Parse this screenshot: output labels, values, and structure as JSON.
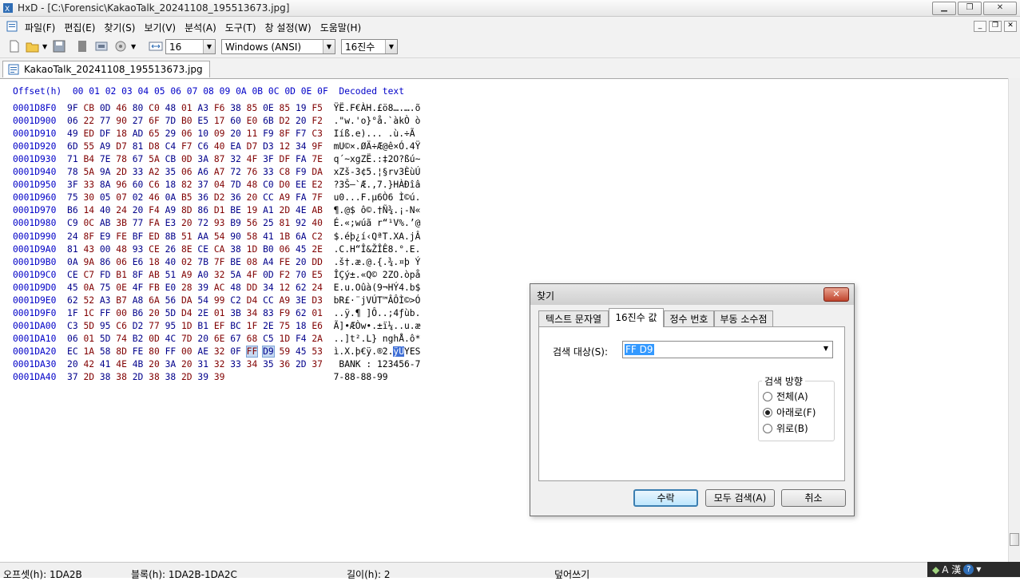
{
  "window": {
    "title": "HxD - [C:\\Forensic\\KakaoTalk_20241108_195513673.jpg]"
  },
  "menu": [
    "파일(F)",
    "편집(E)",
    "찾기(S)",
    "보기(V)",
    "분석(A)",
    "도구(T)",
    "창 설정(W)",
    "도움말(H)"
  ],
  "toolbar": {
    "bytes_per_row": "16",
    "charset": "Windows (ANSI)",
    "base": "16진수"
  },
  "tab": {
    "label": "KakaoTalk_20241108_195513673.jpg"
  },
  "hex": {
    "header_offset": "Offset(h)",
    "header_columns": [
      "00",
      "01",
      "02",
      "03",
      "04",
      "05",
      "06",
      "07",
      "08",
      "09",
      "0A",
      "0B",
      "0C",
      "0D",
      "0E",
      "0F"
    ],
    "header_text": "Decoded text",
    "rows": [
      {
        "offset": "0001D8F0",
        "bytes": [
          "9F",
          "CB",
          "0D",
          "46",
          "80",
          "C0",
          "48",
          "01",
          "A3",
          "F6",
          "38",
          "85",
          "0E",
          "85",
          "19",
          "F5"
        ],
        "text": "ŸË.F€ÀH.£ö8….….õ"
      },
      {
        "offset": "0001D900",
        "bytes": [
          "06",
          "22",
          "77",
          "90",
          "27",
          "6F",
          "7D",
          "B0",
          "E5",
          "17",
          "60",
          "E0",
          "6B",
          "D2",
          "20",
          "F2"
        ],
        "text": ".\"w.'o}°å.`àkÒ ò"
      },
      {
        "offset": "0001D910",
        "bytes": [
          "49",
          "ED",
          "DF",
          "18",
          "AD",
          "65",
          "29",
          "06",
          "10",
          "09",
          "20",
          "11",
          "F9",
          "8F",
          "F7",
          "C3"
        ],
        "text": "Iíß.­e)... .ù.÷Ã"
      },
      {
        "offset": "0001D920",
        "bytes": [
          "6D",
          "55",
          "A9",
          "D7",
          "81",
          "D8",
          "C4",
          "F7",
          "C6",
          "40",
          "EA",
          "D7",
          "D3",
          "12",
          "34",
          "9F"
        ],
        "text": "mU©×.ØÄ÷Æ@ê×Ó.4Ÿ"
      },
      {
        "offset": "0001D930",
        "bytes": [
          "71",
          "B4",
          "7E",
          "78",
          "67",
          "5A",
          "CB",
          "0D",
          "3A",
          "87",
          "32",
          "4F",
          "3F",
          "DF",
          "FA",
          "7E"
        ],
        "text": "q´~xgZË.:‡2O?ßú~"
      },
      {
        "offset": "0001D940",
        "bytes": [
          "78",
          "5A",
          "9A",
          "2D",
          "33",
          "A2",
          "35",
          "06",
          "A6",
          "A7",
          "72",
          "76",
          "33",
          "C8",
          "F9",
          "DA"
        ],
        "text": "xZš-3¢5.¦§rv3ÈùÚ"
      },
      {
        "offset": "0001D950",
        "bytes": [
          "3F",
          "33",
          "8A",
          "96",
          "60",
          "C6",
          "18",
          "82",
          "37",
          "04",
          "7D",
          "48",
          "C0",
          "D0",
          "EE",
          "E2"
        ],
        "text": "?3Š–`Æ.‚7.}HÀÐîâ"
      },
      {
        "offset": "0001D960",
        "bytes": [
          "75",
          "30",
          "05",
          "07",
          "02",
          "46",
          "0A",
          "B5",
          "36",
          "D2",
          "36",
          "20",
          "CC",
          "A9",
          "FA",
          "7F"
        ],
        "text": "u0...F.µ6Ò6 Ì©ú."
      },
      {
        "offset": "0001D970",
        "bytes": [
          "B6",
          "14",
          "40",
          "24",
          "20",
          "F4",
          "A9",
          "8D",
          "86",
          "D1",
          "BE",
          "19",
          "A1",
          "2D",
          "4E",
          "AB"
        ],
        "text": "¶.@$ ô©.†Ñ¾.¡-N«"
      },
      {
        "offset": "0001D980",
        "bytes": [
          "C9",
          "0C",
          "AB",
          "3B",
          "77",
          "FA",
          "E3",
          "20",
          "72",
          "93",
          "B9",
          "56",
          "25",
          "81",
          "92",
          "40"
        ],
        "text": "É.«;wúã r“¹V%.’@"
      },
      {
        "offset": "0001D990",
        "bytes": [
          "24",
          "8F",
          "E9",
          "FE",
          "BF",
          "ED",
          "8B",
          "51",
          "AA",
          "54",
          "90",
          "58",
          "41",
          "1B",
          "6A",
          "C2"
        ],
        "text": "$.éþ¿í‹QªT.XA.jÂ"
      },
      {
        "offset": "0001D9A0",
        "bytes": [
          "81",
          "43",
          "00",
          "48",
          "93",
          "CE",
          "26",
          "8E",
          "CE",
          "CA",
          "38",
          "1D",
          "B0",
          "06",
          "45",
          "2E"
        ],
        "text": ".C.H“Î&ŽÎÊ8.°.E."
      },
      {
        "offset": "0001D9B0",
        "bytes": [
          "0A",
          "9A",
          "86",
          "06",
          "E6",
          "18",
          "40",
          "02",
          "7B",
          "7F",
          "BE",
          "08",
          "A4",
          "FE",
          "20",
          "DD"
        ],
        "text": ".š†.æ.@.{.¾.¤þ Ý"
      },
      {
        "offset": "0001D9C0",
        "bytes": [
          "CE",
          "C7",
          "FD",
          "B1",
          "8F",
          "AB",
          "51",
          "A9",
          "A0",
          "32",
          "5A",
          "4F",
          "0D",
          "F2",
          "70",
          "E5"
        ],
        "text": "ÎÇý±.«Q© 2ZO.òpå"
      },
      {
        "offset": "0001D9D0",
        "bytes": [
          "45",
          "0A",
          "75",
          "0E",
          "4F",
          "FB",
          "E0",
          "28",
          "39",
          "AC",
          "48",
          "DD",
          "34",
          "12",
          "62",
          "24"
        ],
        "text": "E.u.Oûà(9¬HÝ4.b$"
      },
      {
        "offset": "0001D9E0",
        "bytes": [
          "62",
          "52",
          "A3",
          "B7",
          "A8",
          "6A",
          "56",
          "DA",
          "54",
          "99",
          "C2",
          "D4",
          "CC",
          "A9",
          "3E",
          "D3"
        ],
        "text": "bR£·¨jVÚT™ÂÔÌ©>Ó"
      },
      {
        "offset": "0001D9F0",
        "bytes": [
          "1F",
          "1C",
          "FF",
          "00",
          "B6",
          "20",
          "5D",
          "D4",
          "2E",
          "01",
          "3B",
          "34",
          "83",
          "F9",
          "62",
          "01"
        ],
        "text": "..ÿ.¶ ]Ô..;4ƒùb."
      },
      {
        "offset": "0001DA00",
        "bytes": [
          "C3",
          "5D",
          "95",
          "C6",
          "D2",
          "77",
          "95",
          "1D",
          "B1",
          "EF",
          "BC",
          "1F",
          "2E",
          "75",
          "18",
          "E6"
        ],
        "text": "Ã]•ÆÒw•.±ï¼..u.æ"
      },
      {
        "offset": "0001DA10",
        "bytes": [
          "06",
          "01",
          "5D",
          "74",
          "B2",
          "0D",
          "4C",
          "7D",
          "20",
          "6E",
          "67",
          "68",
          "C5",
          "1D",
          "F4",
          "2A"
        ],
        "text": "..]t².L} nghÅ.ô*"
      },
      {
        "offset": "0001DA20",
        "bytes": [
          "EC",
          "1A",
          "58",
          "8D",
          "FE",
          "80",
          "FF",
          "00",
          "AE",
          "32",
          "0F",
          "FF",
          "D9",
          "59",
          "45",
          "53"
        ],
        "text": "ì.X.þ€ÿ.®2.ÿÙYES"
      },
      {
        "offset": "0001DA30",
        "bytes": [
          "20",
          "42",
          "41",
          "4E",
          "4B",
          "20",
          "3A",
          "20",
          "31",
          "32",
          "33",
          "34",
          "35",
          "36",
          "2D",
          "37"
        ],
        "text": " BANK : 123456-7"
      },
      {
        "offset": "0001DA40",
        "bytes": [
          "37",
          "2D",
          "38",
          "38",
          "2D",
          "38",
          "38",
          "2D",
          "39",
          "39"
        ],
        "text": "7-88-88-99"
      }
    ]
  },
  "status": {
    "offset": "오프셋(h): 1DA2B",
    "block": "블록(h): 1DA2B-1DA2C",
    "length": "길이(h): 2",
    "mode": "덮어쓰기"
  },
  "ime": {
    "text": "A 漢"
  },
  "dialog": {
    "title": "찾기",
    "tabs": [
      "텍스트 문자열",
      "16진수 값",
      "정수 번호",
      "부동 소수점"
    ],
    "active_tab": 1,
    "search_label": "검색 대상(S):",
    "search_value": "FF D9",
    "direction_label": "검색 방향",
    "directions": [
      {
        "label": "전체(A)",
        "selected": false
      },
      {
        "label": "아래로(F)",
        "selected": true
      },
      {
        "label": "위로(B)",
        "selected": false
      }
    ],
    "ok": "수락",
    "search_all": "모두 검색(A)",
    "cancel": "취소"
  }
}
